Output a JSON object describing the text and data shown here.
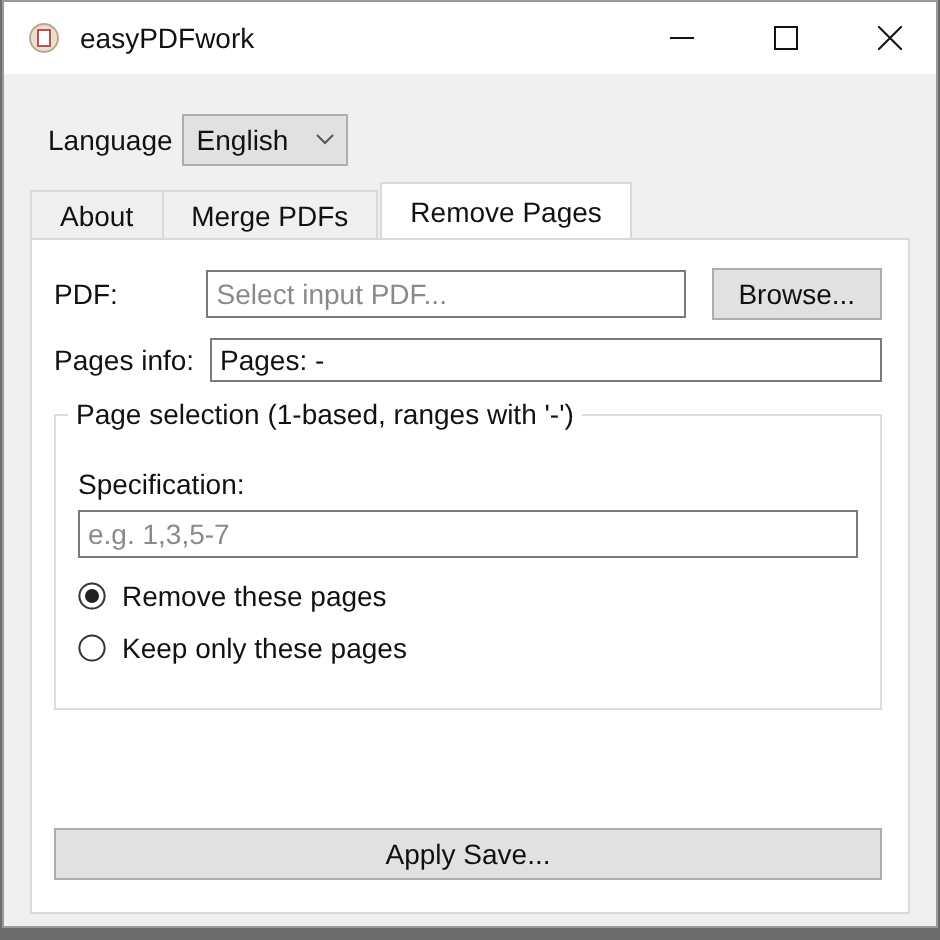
{
  "window": {
    "title": "easyPDFwork"
  },
  "language": {
    "label": "Language",
    "value": "English"
  },
  "tabs": [
    {
      "label": "About",
      "selected": false
    },
    {
      "label": "Merge PDFs",
      "selected": false
    },
    {
      "label": "Remove Pages",
      "selected": true
    }
  ],
  "pdf": {
    "label": "PDF:",
    "placeholder": "Select input PDF...",
    "button": "Browse..."
  },
  "pages_info": {
    "label": "Pages info:",
    "value": "Pages: -"
  },
  "page_selection": {
    "title": "Page selection (1-based, ranges with '-')",
    "specification_label": "Specification:",
    "placeholder": "e.g. 1,3,5-7",
    "options": [
      {
        "label": "Remove these pages",
        "selected": true
      },
      {
        "label": "Keep only these pages",
        "selected": false
      }
    ]
  },
  "apply_button": "Apply  Save..."
}
